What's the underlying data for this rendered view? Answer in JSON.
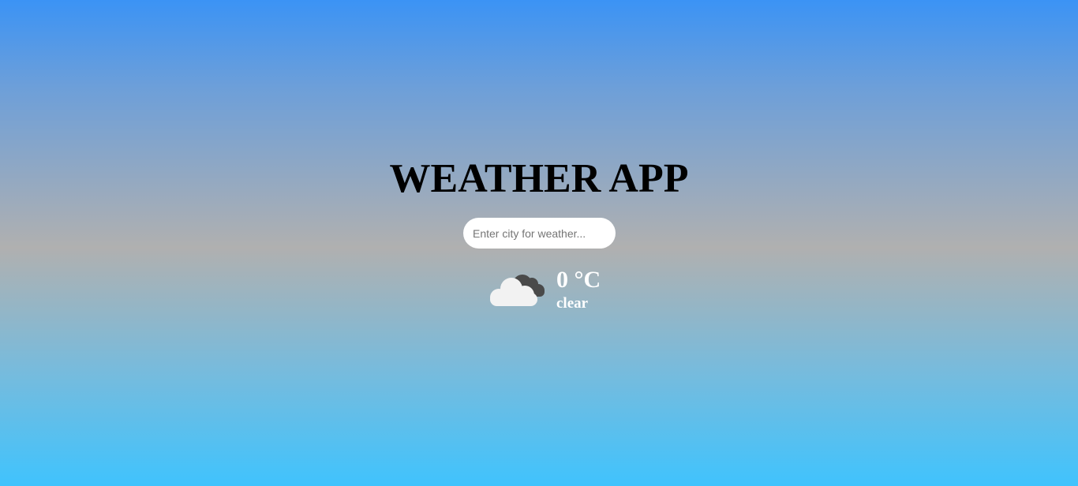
{
  "app": {
    "title": "WEATHER APP"
  },
  "search": {
    "placeholder": "Enter city for weather...",
    "value": ""
  },
  "weather": {
    "icon": "cloudy-icon",
    "temperature": "0 °C",
    "description": "clear"
  },
  "colors": {
    "gradient_top": "#3b93f5",
    "gradient_middle": "#b0b0b0",
    "gradient_bottom": "#40c3fd",
    "title": "#000000",
    "text": "#ffffff",
    "cloud_light": "#f2f2f2",
    "cloud_dark": "#4a4a4a"
  }
}
